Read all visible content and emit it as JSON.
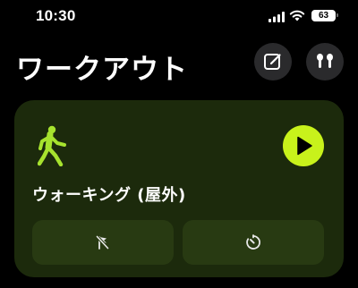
{
  "status_bar": {
    "time": "10:30",
    "battery_level": "63",
    "icons": [
      "signal-icon",
      "wifi-icon",
      "battery-icon"
    ]
  },
  "header": {
    "title": "ワークアウト",
    "buttons": [
      "edit-icon",
      "airpods-icon"
    ]
  },
  "workout_card": {
    "name": "ウォーキング (屋外)",
    "activity_icon": "walking-figure-icon",
    "start_icon": "play-icon",
    "options": [
      {
        "icon": "no-goal-flag-icon"
      },
      {
        "icon": "timer-icon"
      }
    ]
  },
  "colors": {
    "background": "#000000",
    "card": "#1c2a0c",
    "card_button": "#283a12",
    "accent": "#c8f21b",
    "header_button": "#2a2a2c"
  }
}
